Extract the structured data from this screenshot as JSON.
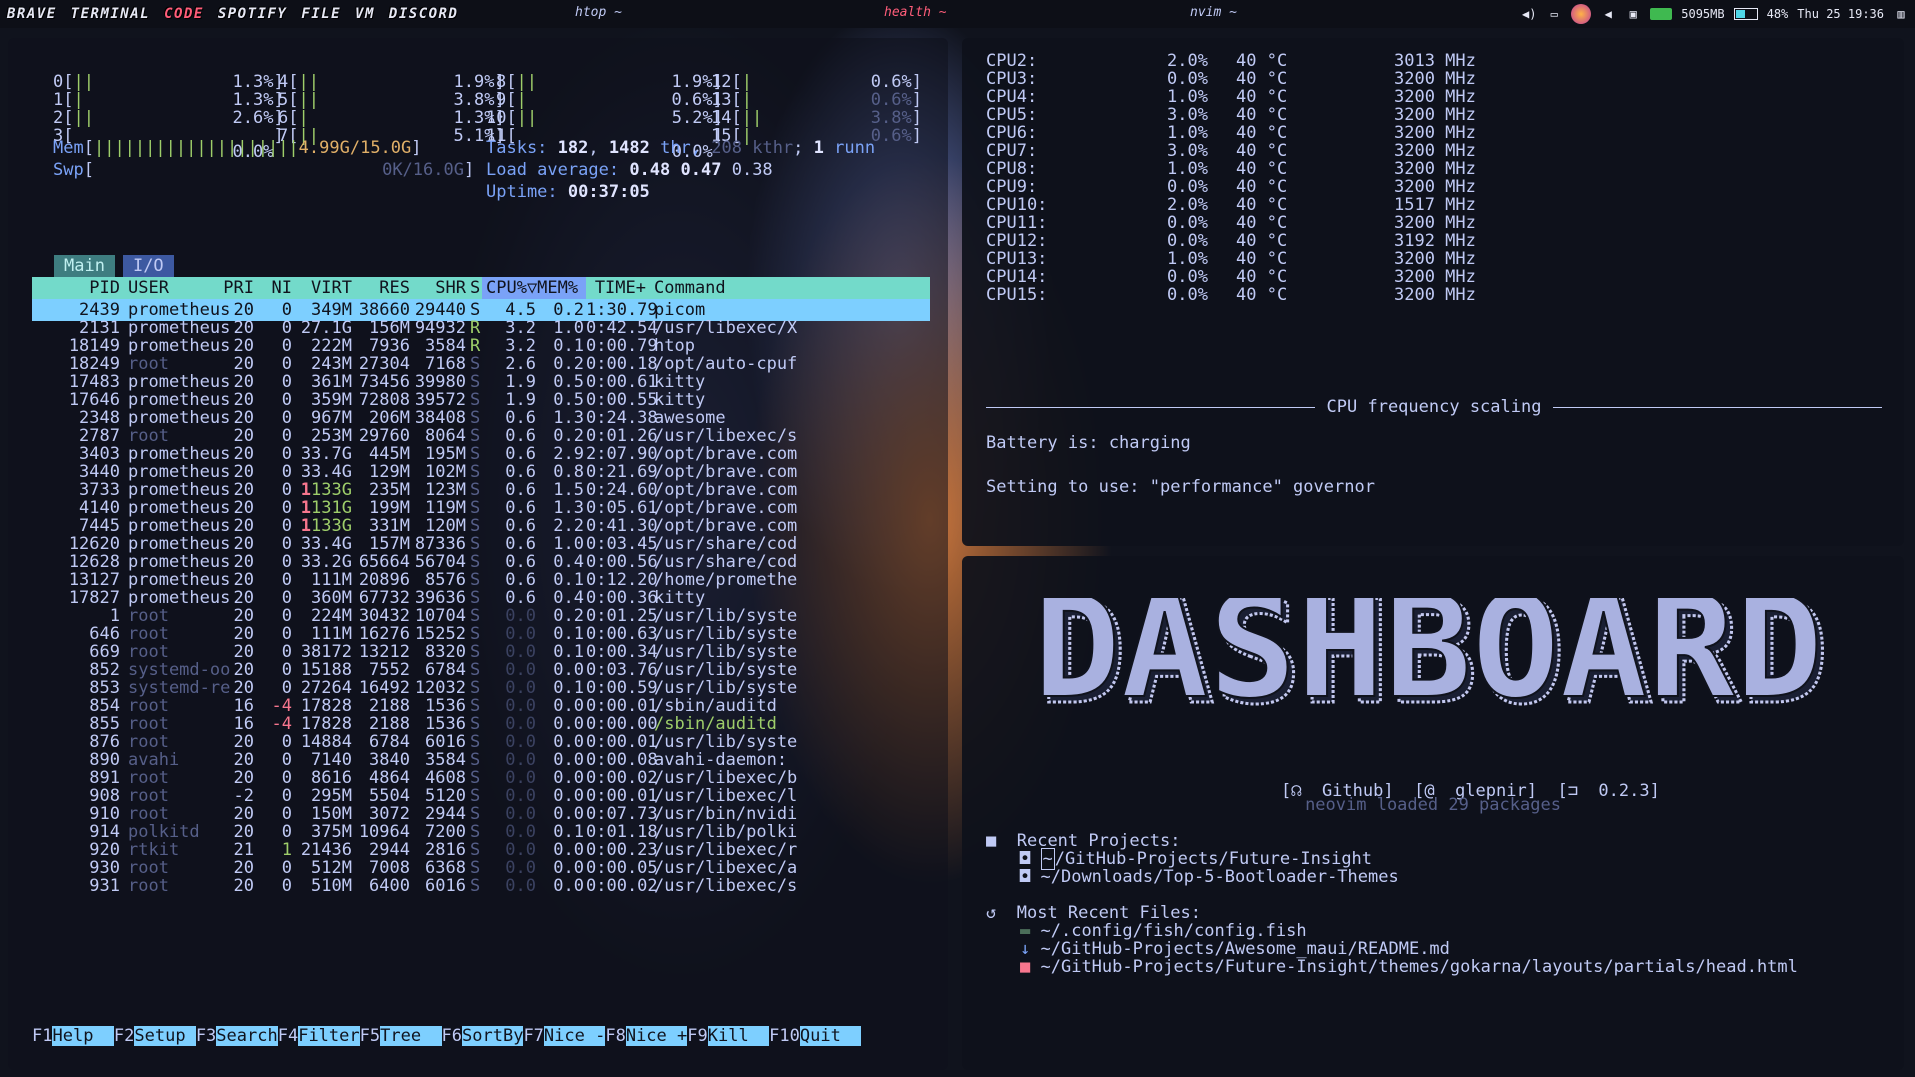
{
  "topbar": {
    "tags": [
      {
        "label": "BRAVE",
        "active": false
      },
      {
        "label": "TERMINAL",
        "active": false
      },
      {
        "label": "CODE",
        "active": true
      },
      {
        "label": "SPOTIFY",
        "active": false
      },
      {
        "label": "FILE",
        "active": false
      },
      {
        "label": "VM",
        "active": false
      },
      {
        "label": "DISCORD",
        "active": false
      }
    ],
    "left_title": "htop ~",
    "center_title": "health ~",
    "right_title": "nvim ~",
    "memory": "5095MB",
    "battery": "48%",
    "battery_level": 0.48,
    "clock": "Thu 25 19:36"
  },
  "htop": {
    "cpus": [
      {
        "id": "0",
        "bar": "||",
        "pct": "1.3%"
      },
      {
        "id": "1",
        "bar": "|",
        "pct": "1.3%"
      },
      {
        "id": "2",
        "bar": "||",
        "pct": "2.6%"
      },
      {
        "id": "3",
        "bar": "",
        "pct": "0.0%"
      },
      {
        "id": "4",
        "bar": "||",
        "pct": "1.9%"
      },
      {
        "id": "5",
        "bar": "||",
        "pct": "3.8%"
      },
      {
        "id": "6",
        "bar": "|",
        "pct": "1.3%"
      },
      {
        "id": "7",
        "bar": "||",
        "pct": "5.1%"
      },
      {
        "id": "8",
        "bar": "||",
        "pct": "1.9%"
      },
      {
        "id": "9",
        "bar": "|",
        "pct": "0.6%"
      },
      {
        "id": "10",
        "bar": "||",
        "pct": "5.2%"
      },
      {
        "id": "11",
        "bar": "",
        "pct": "0.0%"
      },
      {
        "id": "12",
        "bar": "|",
        "pct": "0.6%"
      },
      {
        "id": "13",
        "bar": "|",
        "pct": "0.6%"
      },
      {
        "id": "14",
        "bar": "||",
        "pct": "3.8%"
      },
      {
        "id": "15",
        "bar": "|",
        "pct": "0.6%"
      }
    ],
    "mem_label": "Mem",
    "mem_bar": "||||||||||||||||||||",
    "mem_value": "4.99G/15.0G",
    "swp_label": "Swp",
    "swp_value": "0K/16.0G",
    "tasks_label": "Tasks:",
    "tasks": "182",
    "thr": "1482",
    "thr_label": "thr,",
    "kthr": "208 kthr",
    "running": "1",
    "running_label": "runn",
    "load_label": "Load average:",
    "load1": "0.48",
    "load5": "0.47",
    "load15": "0.38",
    "uptime_label": "Uptime:",
    "uptime": "00:37:05",
    "tab_main": "Main",
    "tab_io": "I/O",
    "columns": [
      "PID",
      "USER",
      "PRI",
      "NI",
      "VIRT",
      "RES",
      "SHR",
      "S",
      "CPU%▽MEM%",
      "TIME+",
      "Command"
    ],
    "processes": [
      [
        "2439",
        "prometheus",
        "20",
        "0",
        "349M",
        "38660",
        "29440",
        "S",
        "4.5",
        "0.2",
        "1:30.79",
        "picom"
      ],
      [
        "2131",
        "prometheus",
        "20",
        "0",
        "27.1G",
        "156M",
        "94932",
        "R",
        "3.2",
        "1.0",
        "0:42.54",
        "/usr/libexec/X"
      ],
      [
        "18149",
        "prometheus",
        "20",
        "0",
        "222M",
        "7936",
        "3584",
        "R",
        "3.2",
        "0.1",
        "0:00.79",
        "htop"
      ],
      [
        "18249",
        "root",
        "20",
        "0",
        "243M",
        "27304",
        "7168",
        "S",
        "2.6",
        "0.2",
        "0:00.18",
        "/opt/auto-cpuf"
      ],
      [
        "17483",
        "prometheus",
        "20",
        "0",
        "361M",
        "73456",
        "39980",
        "S",
        "1.9",
        "0.5",
        "0:00.61",
        "kitty"
      ],
      [
        "17646",
        "prometheus",
        "20",
        "0",
        "359M",
        "72808",
        "39572",
        "S",
        "1.9",
        "0.5",
        "0:00.55",
        "kitty"
      ],
      [
        "2348",
        "prometheus",
        "20",
        "0",
        "967M",
        "206M",
        "38408",
        "S",
        "0.6",
        "1.3",
        "0:24.38",
        "awesome"
      ],
      [
        "2787",
        "root",
        "20",
        "0",
        "253M",
        "29760",
        "8064",
        "S",
        "0.6",
        "0.2",
        "0:01.26",
        "/usr/libexec/s"
      ],
      [
        "3403",
        "prometheus",
        "20",
        "0",
        "33.7G",
        "445M",
        "195M",
        "S",
        "0.6",
        "2.9",
        "2:07.90",
        "/opt/brave.com"
      ],
      [
        "3440",
        "prometheus",
        "20",
        "0",
        "33.4G",
        "129M",
        "102M",
        "S",
        "0.6",
        "0.8",
        "0:21.69",
        "/opt/brave.com"
      ],
      [
        "3733",
        "prometheus",
        "20",
        "0",
        "1133G",
        "235M",
        "123M",
        "S",
        "0.6",
        "1.5",
        "0:24.60",
        "/opt/brave.com"
      ],
      [
        "4140",
        "prometheus",
        "20",
        "0",
        "1131G",
        "199M",
        "119M",
        "S",
        "0.6",
        "1.3",
        "0:05.61",
        "/opt/brave.com"
      ],
      [
        "7445",
        "prometheus",
        "20",
        "0",
        "1133G",
        "331M",
        "120M",
        "S",
        "0.6",
        "2.2",
        "0:41.30",
        "/opt/brave.com"
      ],
      [
        "12620",
        "prometheus",
        "20",
        "0",
        "33.4G",
        "157M",
        "87336",
        "S",
        "0.6",
        "1.0",
        "0:03.45",
        "/usr/share/cod"
      ],
      [
        "12628",
        "prometheus",
        "20",
        "0",
        "33.2G",
        "65664",
        "56704",
        "S",
        "0.6",
        "0.4",
        "0:00.56",
        "/usr/share/cod"
      ],
      [
        "13127",
        "prometheus",
        "20",
        "0",
        "111M",
        "20896",
        "8576",
        "S",
        "0.6",
        "0.1",
        "0:12.20",
        "/home/promethe"
      ],
      [
        "17827",
        "prometheus",
        "20",
        "0",
        "360M",
        "67732",
        "39636",
        "S",
        "0.6",
        "0.4",
        "0:00.36",
        "kitty"
      ],
      [
        "1",
        "root",
        "20",
        "0",
        "224M",
        "30432",
        "10704",
        "S",
        "0.0",
        "0.2",
        "0:01.25",
        "/usr/lib/syste"
      ],
      [
        "646",
        "root",
        "20",
        "0",
        "111M",
        "16276",
        "15252",
        "S",
        "0.0",
        "0.1",
        "0:00.63",
        "/usr/lib/syste"
      ],
      [
        "669",
        "root",
        "20",
        "0",
        "38172",
        "13212",
        "8320",
        "S",
        "0.0",
        "0.1",
        "0:00.34",
        "/usr/lib/syste"
      ],
      [
        "852",
        "systemd-oo",
        "20",
        "0",
        "15188",
        "7552",
        "6784",
        "S",
        "0.0",
        "0.0",
        "0:03.76",
        "/usr/lib/syste"
      ],
      [
        "853",
        "systemd-re",
        "20",
        "0",
        "27264",
        "16492",
        "12032",
        "S",
        "0.0",
        "0.1",
        "0:00.59",
        "/usr/lib/syste"
      ],
      [
        "854",
        "root",
        "16",
        "-4",
        "17828",
        "2188",
        "1536",
        "S",
        "0.0",
        "0.0",
        "0:00.01",
        "/sbin/auditd"
      ],
      [
        "855",
        "root",
        "16",
        "-4",
        "17828",
        "2188",
        "1536",
        "S",
        "0.0",
        "0.0",
        "0:00.00",
        "/sbin/auditd"
      ],
      [
        "876",
        "root",
        "20",
        "0",
        "14884",
        "6784",
        "6016",
        "S",
        "0.0",
        "0.0",
        "0:00.01",
        "/usr/lib/syste"
      ],
      [
        "890",
        "avahi",
        "20",
        "0",
        "7140",
        "3840",
        "3584",
        "S",
        "0.0",
        "0.0",
        "0:00.08",
        "avahi-daemon:"
      ],
      [
        "891",
        "root",
        "20",
        "0",
        "8616",
        "4864",
        "4608",
        "S",
        "0.0",
        "0.0",
        "0:00.02",
        "/usr/libexec/b"
      ],
      [
        "908",
        "root",
        "-2",
        "0",
        "295M",
        "5504",
        "5120",
        "S",
        "0.0",
        "0.0",
        "0:00.01",
        "/usr/libexec/l"
      ],
      [
        "910",
        "root",
        "20",
        "0",
        "150M",
        "3072",
        "2944",
        "S",
        "0.0",
        "0.0",
        "0:07.73",
        "/usr/bin/nvidi"
      ],
      [
        "914",
        "polkitd",
        "20",
        "0",
        "375M",
        "10964",
        "7200",
        "S",
        "0.0",
        "0.1",
        "0:01.18",
        "/usr/lib/polki"
      ],
      [
        "920",
        "rtkit",
        "21",
        "1",
        "21436",
        "2944",
        "2816",
        "S",
        "0.0",
        "0.0",
        "0:00.23",
        "/usr/libexec/r"
      ],
      [
        "930",
        "root",
        "20",
        "0",
        "512M",
        "7008",
        "6368",
        "S",
        "0.0",
        "0.0",
        "0:00.05",
        "/usr/libexec/a"
      ],
      [
        "931",
        "root",
        "20",
        "0",
        "510M",
        "6400",
        "6016",
        "S",
        "0.0",
        "0.0",
        "0:00.02",
        "/usr/libexec/s"
      ]
    ],
    "fkeys": [
      {
        "key": "F1",
        "action": "Help  "
      },
      {
        "key": "F2",
        "action": "Setup "
      },
      {
        "key": "F3",
        "action": "Search"
      },
      {
        "key": "F4",
        "action": "Filter"
      },
      {
        "key": "F5",
        "action": "Tree  "
      },
      {
        "key": "F6",
        "action": "SortBy"
      },
      {
        "key": "F7",
        "action": "Nice -"
      },
      {
        "key": "F8",
        "action": "Nice +"
      },
      {
        "key": "F9",
        "action": "Kill  "
      },
      {
        "key": "F10",
        "action": "Quit  "
      }
    ]
  },
  "cpufreq": {
    "rows": [
      {
        "cpu": "CPU2:",
        "usage": "2.0%",
        "temp": "40 °C",
        "freq": "3013 MHz"
      },
      {
        "cpu": "CPU3:",
        "usage": "0.0%",
        "temp": "40 °C",
        "freq": "3200 MHz"
      },
      {
        "cpu": "CPU4:",
        "usage": "1.0%",
        "temp": "40 °C",
        "freq": "3200 MHz"
      },
      {
        "cpu": "CPU5:",
        "usage": "3.0%",
        "temp": "40 °C",
        "freq": "3200 MHz"
      },
      {
        "cpu": "CPU6:",
        "usage": "1.0%",
        "temp": "40 °C",
        "freq": "3200 MHz"
      },
      {
        "cpu": "CPU7:",
        "usage": "3.0%",
        "temp": "40 °C",
        "freq": "3200 MHz"
      },
      {
        "cpu": "CPU8:",
        "usage": "1.0%",
        "temp": "40 °C",
        "freq": "3200 MHz"
      },
      {
        "cpu": "CPU9:",
        "usage": "0.0%",
        "temp": "40 °C",
        "freq": "3200 MHz"
      },
      {
        "cpu": "CPU10:",
        "usage": "2.0%",
        "temp": "40 °C",
        "freq": "1517 MHz"
      },
      {
        "cpu": "CPU11:",
        "usage": "0.0%",
        "temp": "40 °C",
        "freq": "3200 MHz"
      },
      {
        "cpu": "CPU12:",
        "usage": "0.0%",
        "temp": "40 °C",
        "freq": "3192 MHz"
      },
      {
        "cpu": "CPU13:",
        "usage": "1.0%",
        "temp": "40 °C",
        "freq": "3200 MHz"
      },
      {
        "cpu": "CPU14:",
        "usage": "0.0%",
        "temp": "40 °C",
        "freq": "3200 MHz"
      },
      {
        "cpu": "CPU15:",
        "usage": "0.0%",
        "temp": "40 °C",
        "freq": "3200 MHz"
      }
    ],
    "section_title": "CPU frequency scaling",
    "battery_line": "Battery is: charging",
    "governor_line": "Setting to use: \"performance\" governor"
  },
  "dashboard": {
    "logo_text": "DASHBOARD",
    "links": [
      {
        "icon": "github-icon",
        "label": "Github]"
      },
      {
        "icon": "at-icon",
        "label": "glepnir]"
      },
      {
        "icon": "tag-icon",
        "label": "0.2.3]"
      }
    ],
    "loaded": "neovim loaded 29 packages",
    "recent_projects_title": "Recent Projects:",
    "recent_projects": [
      "/GitHub-Projects/Future-Insight",
      "~/Downloads/Top-5-Bootloader-Themes"
    ],
    "recent_files_title": "Most Recent Files:",
    "recent_files": [
      {
        "icon": "fish-file-icon",
        "path": "~/.config/fish/config.fish"
      },
      {
        "icon": "markdown-file-icon",
        "path": "~/GitHub-Projects/Awesome_maui/README.md"
      },
      {
        "icon": "html-file-icon",
        "path": "~/GitHub-Projects/Future-Insight/themes/gokarna/layouts/partials/head.html"
      }
    ]
  }
}
